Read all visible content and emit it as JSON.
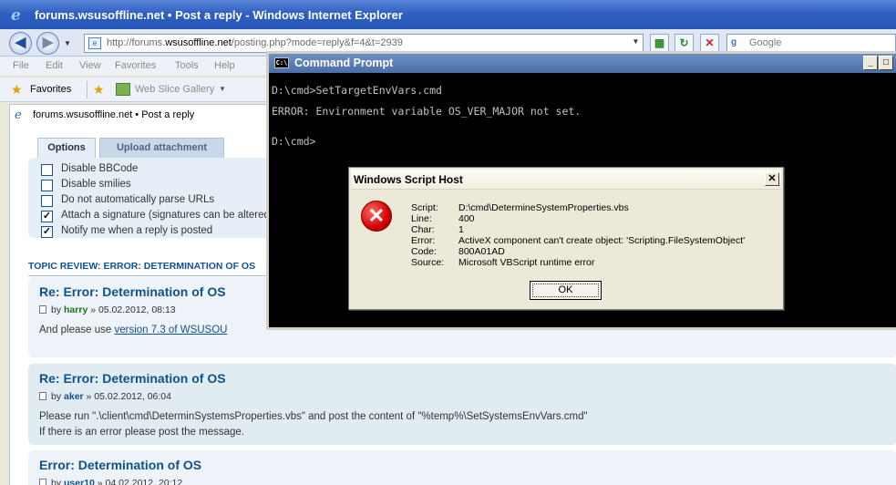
{
  "ie": {
    "title": "forums.wsusoffline.net • Post a reply - Windows Internet Explorer",
    "url_prefix": "http://forums.",
    "url_domain": "wsusoffline.net",
    "url_suffix": "/posting.php?mode=reply&f=4&t=2939",
    "search_placeholder": "Google",
    "menu": [
      "File",
      "Edit",
      "View",
      "Favorites",
      "Tools",
      "Help"
    ],
    "favorites_label": "Favorites",
    "web_slice_label": "Web Slice Gallery",
    "tab_label": "forums.wsusoffline.net • Post a reply"
  },
  "options": {
    "tabs": [
      "Options",
      "Upload attachment"
    ],
    "items": [
      {
        "label": "Disable BBCode",
        "checked": false
      },
      {
        "label": "Disable smilies",
        "checked": false
      },
      {
        "label": "Do not automatically parse URLs",
        "checked": false
      },
      {
        "label": "Attach a signature (signatures can be altered and added",
        "checked": true
      },
      {
        "label": "Notify me when a reply is posted",
        "checked": true
      }
    ]
  },
  "topic_review": {
    "heading": "TOPIC REVIEW: ERROR: DETERMINATION OF OS",
    "posts": [
      {
        "title": "Re: Error: Determination of OS",
        "by": "by",
        "author": "harry",
        "date": "» 05.02.2012, 08:13",
        "body_prefix": "And please use ",
        "body_link": "version 7.3 of WSUSOU"
      },
      {
        "title": "Re: Error: Determination of OS",
        "by": "by",
        "author": "aker",
        "date": "» 05.02.2012, 06:04",
        "body_line1": "Please run \".\\client\\cmd\\DeterminSystemsProperties.vbs\" and post the content of \"%temp%\\SetSystemsEnvVars.cmd\"",
        "body_line2": "If there is an error please post the message."
      },
      {
        "title": "Error: Determination of OS",
        "by": "by",
        "author": "user10",
        "date": "» 04.02.2012, 20:12"
      }
    ]
  },
  "cmd": {
    "title": "Command Prompt",
    "lines": [
      "D:\\cmd>SetTargetEnvVars.cmd",
      "ERROR: Environment variable OS_VER_MAJOR not set.",
      "D:\\cmd>"
    ]
  },
  "wsh": {
    "title": "Windows Script Host",
    "rows": [
      {
        "label": "Script:",
        "value": "D:\\cmd\\DetermineSystemProperties.vbs"
      },
      {
        "label": "Line:",
        "value": "400"
      },
      {
        "label": "Char:",
        "value": "1"
      },
      {
        "label": "Error:",
        "value": "ActiveX component can't create object: 'Scripting.FileSystemObject'"
      },
      {
        "label": "Code:",
        "value": "800A01AD"
      },
      {
        "label": "Source:",
        "value": "Microsoft VBScript runtime error"
      }
    ],
    "ok_label": "OK"
  },
  "colors": {
    "ie_titlebar": "#2f5fc1",
    "forum_link": "#105289",
    "post_bg": "#eef3f9",
    "post_bg_alt": "#e1ebf2",
    "cmd_bg": "#000000",
    "cmd_text": "#c0c0c0",
    "error_icon": "#d10000"
  }
}
